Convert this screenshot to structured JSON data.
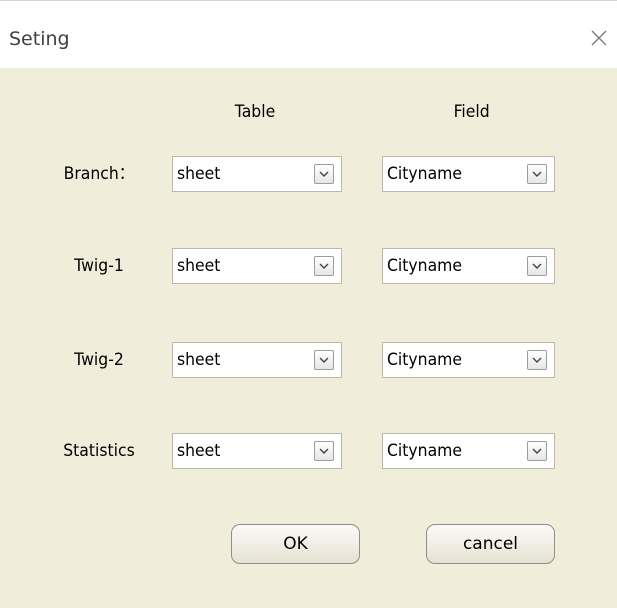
{
  "window": {
    "title": "Seting"
  },
  "columns": {
    "table": "Table",
    "field": "Field"
  },
  "rows": [
    {
      "label": "Branch：",
      "table": "sheet",
      "field": "Cityname"
    },
    {
      "label": "Twig-1",
      "table": "sheet",
      "field": "Cityname"
    },
    {
      "label": "Twig-2",
      "table": "sheet",
      "field": "Cityname"
    },
    {
      "label": "Statistics",
      "table": "sheet",
      "field": "Cityname"
    }
  ],
  "buttons": {
    "ok": "OK",
    "cancel": "cancel"
  },
  "icons": {
    "close": "close-icon",
    "dropdown": "chevron-down-icon"
  },
  "colors": {
    "dialog_background": "#f1eddb",
    "titlebar_background": "#ffffff"
  }
}
